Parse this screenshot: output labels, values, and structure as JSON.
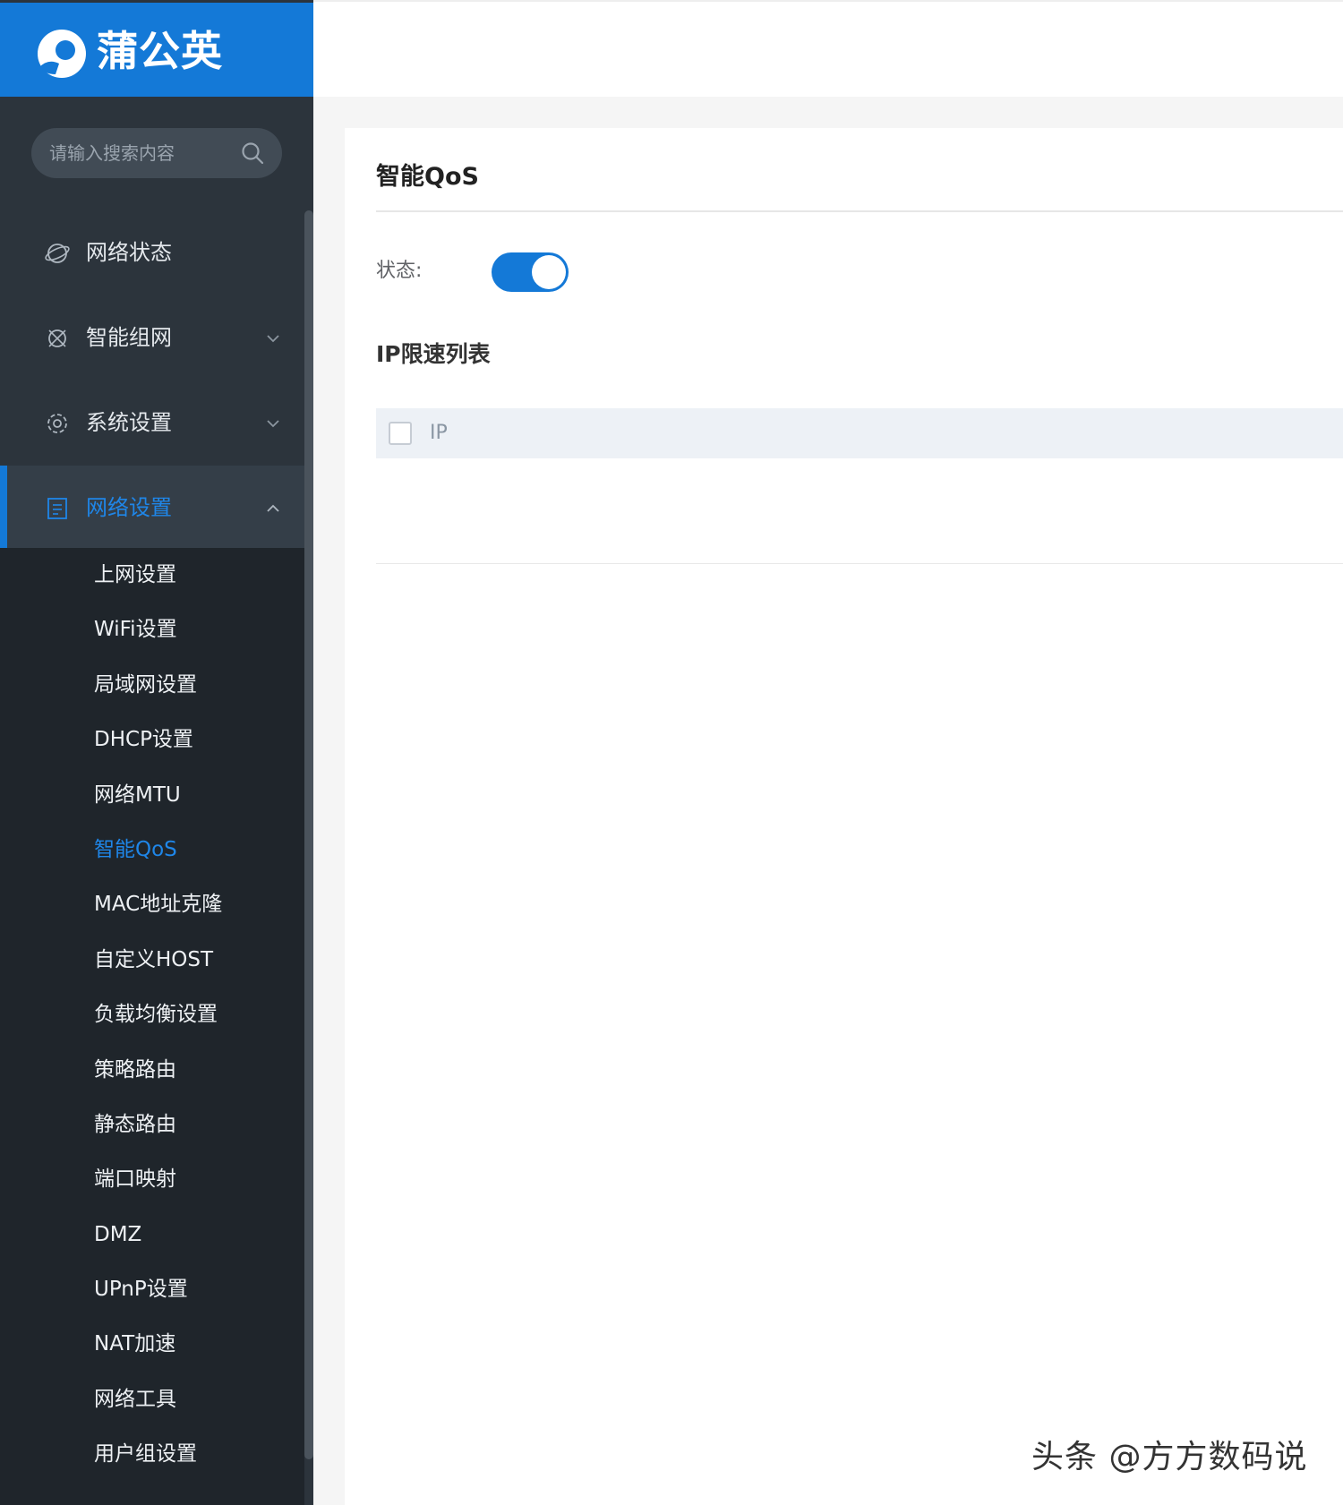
{
  "brand": {
    "name": "蒲公英"
  },
  "search": {
    "placeholder": "请输入搜索内容"
  },
  "menu": [
    {
      "label": "网络状态",
      "icon": "globe-icon",
      "expandable": false
    },
    {
      "label": "智能组网",
      "icon": "network-icon",
      "expandable": true
    },
    {
      "label": "系统设置",
      "icon": "gear-icon",
      "expandable": true
    },
    {
      "label": "网络设置",
      "icon": "document-icon",
      "expandable": true,
      "expanded": true,
      "active": true
    }
  ],
  "submenu": [
    "上网设置",
    "WiFi设置",
    "局域网设置",
    "DHCP设置",
    "网络MTU",
    "智能QoS",
    "MAC地址克隆",
    "自定义HOST",
    "负载均衡设置",
    "策略路由",
    "静态路由",
    "端口映射",
    "DMZ",
    "UPnP设置",
    "NAT加速",
    "网络工具",
    "用户组设置"
  ],
  "submenu_active_index": 5,
  "main": {
    "title": "智能QoS",
    "status_label": "状态:",
    "status_enabled": true,
    "list_title": "IP限速列表",
    "table_header": {
      "ip": "IP"
    }
  },
  "watermark": "头条 @方方数码说",
  "colors": {
    "accent": "#1479d7",
    "sidebar_bg": "#2c343c",
    "submenu_bg": "#1f252b",
    "active_text": "#1f86e8"
  }
}
